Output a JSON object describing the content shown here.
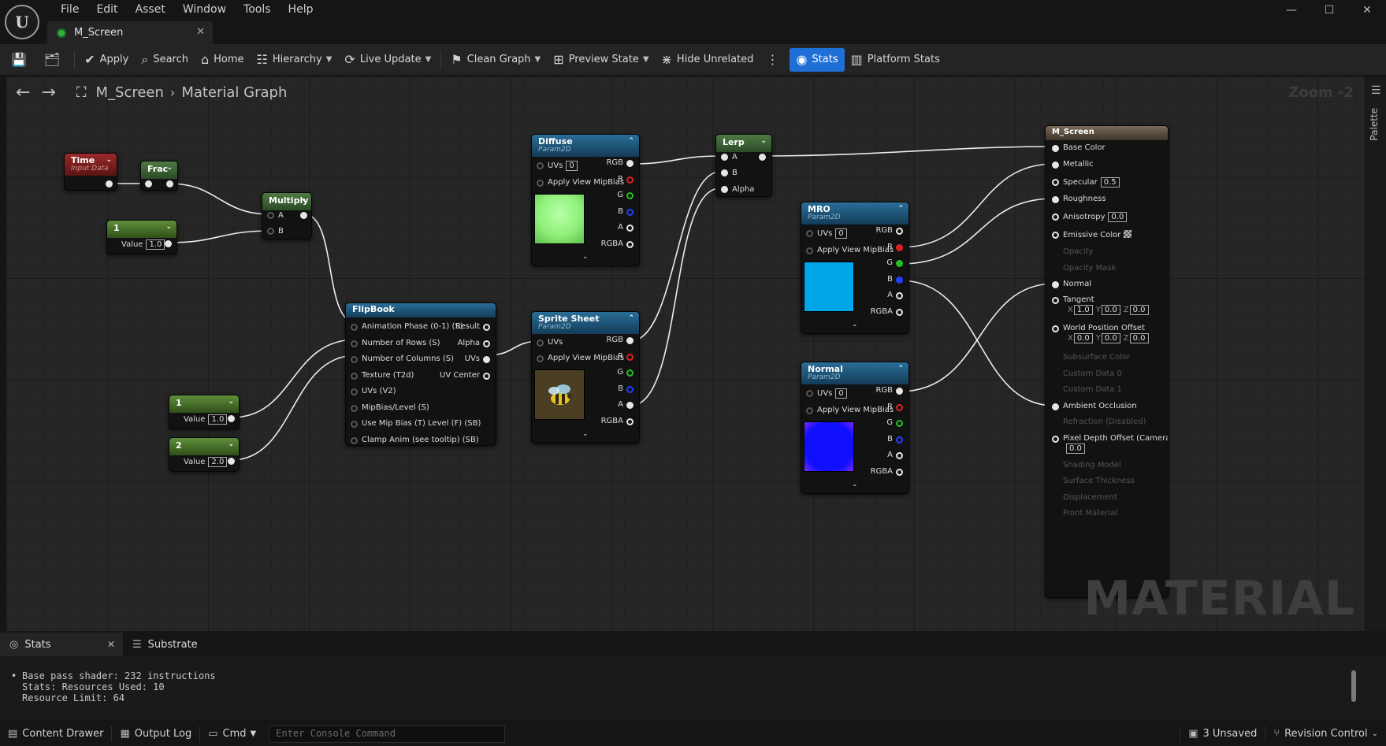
{
  "app": {
    "menu": [
      "File",
      "Edit",
      "Asset",
      "Window",
      "Tools",
      "Help"
    ],
    "tab_title": "M_Screen",
    "window_controls": {
      "minimize": "—",
      "maximize": "☐",
      "close": "✕"
    }
  },
  "toolbar": {
    "apply": "Apply",
    "search": "Search",
    "home": "Home",
    "hierarchy": "Hierarchy",
    "live_update": "Live Update",
    "clean_graph": "Clean Graph",
    "preview_state": "Preview State",
    "hide_unrelated": "Hide Unrelated",
    "stats": "Stats",
    "platform_stats": "Platform Stats"
  },
  "graph": {
    "breadcrumb": [
      "M_Screen",
      "Material Graph"
    ],
    "zoom": "Zoom -2",
    "watermark": "MATERIAL",
    "palette_label": "Palette"
  },
  "nodes": {
    "time": {
      "title": "Time",
      "subtitle": "Input Data",
      "color": "#9a2a2a"
    },
    "frac": {
      "title": "Frac"
    },
    "const1": {
      "title": "1",
      "value_label": "Value",
      "value": "1.0"
    },
    "multiply": {
      "title": "Multiply",
      "pins": [
        "A",
        "B"
      ]
    },
    "flipbook": {
      "title": "FlipBook",
      "inputs": [
        "Animation Phase (0-1) (S)",
        "Number of Rows (S)",
        "Number of Columns (S)",
        "Texture (T2d)",
        "UVs (V2)",
        "MipBias/Level (S)",
        "Use Mip Bias (T) Level (F) (SB)",
        "Clamp Anim (see tooltip) (SB)"
      ],
      "outputs": [
        "Result",
        "Alpha",
        "UVs",
        "UV Center"
      ]
    },
    "rows_const": {
      "title": "1",
      "value_label": "Value",
      "value": "1.0"
    },
    "cols_const": {
      "title": "2",
      "value_label": "Value",
      "value": "2.0"
    },
    "diffuse": {
      "title": "Diffuse",
      "subtitle": "Param2D",
      "uvs_label": "UVs",
      "uvs_value": "0",
      "mip_label": "Apply View MipBias",
      "outputs": [
        "RGB",
        "R",
        "G",
        "B",
        "A",
        "RGBA"
      ],
      "thumb_color": "#8ff07a"
    },
    "sprite": {
      "title": "Sprite Sheet",
      "subtitle": "Param2D",
      "uvs_label": "UVs",
      "mip_label": "Apply View MipBias",
      "outputs": [
        "RGB",
        "R",
        "G",
        "B",
        "A",
        "RGBA"
      ]
    },
    "lerp": {
      "title": "Lerp",
      "pins": [
        "A",
        "B",
        "Alpha"
      ]
    },
    "mro": {
      "title": "MRO",
      "subtitle": "Param2D",
      "uvs_label": "UVs",
      "uvs_value": "0",
      "mip_label": "Apply View MipBias",
      "outputs": [
        "RGB",
        "R",
        "G",
        "B",
        "A",
        "RGBA"
      ],
      "thumb_color": "#00a6e8"
    },
    "normal": {
      "title": "Normal",
      "subtitle": "Param2D",
      "uvs_label": "UVs",
      "uvs_value": "0",
      "mip_label": "Apply View MipBias",
      "outputs": [
        "RGB",
        "R",
        "G",
        "B",
        "A",
        "RGBA"
      ],
      "thumb_color": "#1010ff"
    },
    "result": {
      "title": "M_Screen",
      "base_color": "Base Color",
      "metallic": "Metallic",
      "specular": "Specular",
      "specular_value": "0.5",
      "roughness": "Roughness",
      "anisotropy": "Anisotropy",
      "anisotropy_value": "0.0",
      "emissive": "Emissive Color",
      "opacity": "Opacity",
      "opacity_mask": "Opacity Mask",
      "normal": "Normal",
      "tangent": "Tangent",
      "tangent_x": "1.0",
      "tangent_y": "0.0",
      "tangent_z": "0.0",
      "wpo": "World Position Offset",
      "wpo_x": "0.0",
      "wpo_y": "0.0",
      "wpo_z": "0.0",
      "subsurface": "Subsurface Color",
      "custom0": "Custom Data 0",
      "custom1": "Custom Data 1",
      "ao": "Ambient Occlusion",
      "refraction": "Refraction (Disabled)",
      "pdo": "Pixel Depth Offset (Camera Vector)",
      "pdo_value": "0.0",
      "shading_model": "Shading Model",
      "surface_thickness": "Surface Thickness",
      "displacement": "Displacement",
      "front_material": "Front Material",
      "axis_x": "X",
      "axis_y": "Y",
      "axis_z": "Z"
    }
  },
  "panels": {
    "tabs": [
      "Stats",
      "Substrate"
    ],
    "stats_lines": [
      "Base pass shader: 232 instructions",
      "Stats: Resources Used: 10",
      "Resource Limit: 64"
    ]
  },
  "statusbar": {
    "content_drawer": "Content Drawer",
    "output_log": "Output Log",
    "cmd": "Cmd",
    "console_placeholder": "Enter Console Command",
    "unsaved": "3 Unsaved",
    "revision_control": "Revision Control"
  }
}
